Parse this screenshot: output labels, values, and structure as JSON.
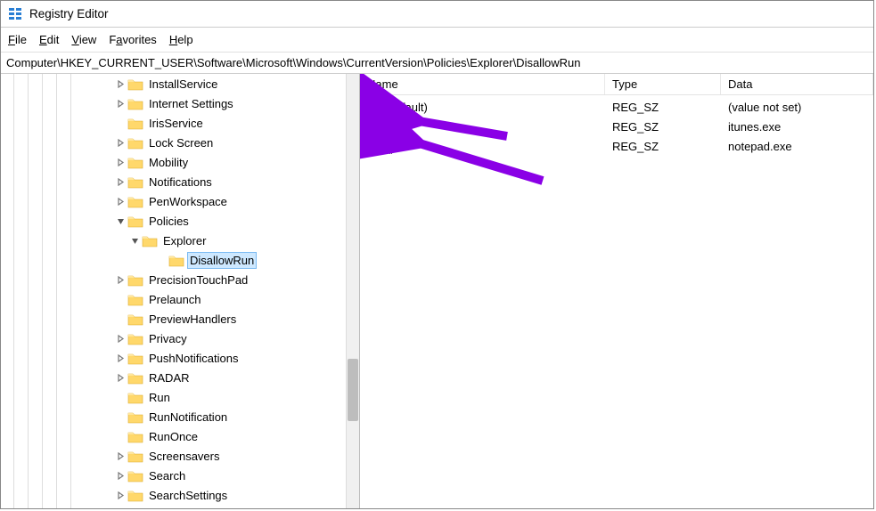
{
  "window": {
    "title": "Registry Editor"
  },
  "menubar": {
    "file": "File",
    "edit": "Edit",
    "view": "View",
    "favorites": "Favorites",
    "help": "Help"
  },
  "address": "Computer\\HKEY_CURRENT_USER\\Software\\Microsoft\\Windows\\CurrentVersion\\Policies\\Explorer\\DisallowRun",
  "tree": {
    "items": [
      {
        "indent": 128,
        "expander": "right",
        "label": "InstallService"
      },
      {
        "indent": 128,
        "expander": "right",
        "label": "Internet Settings"
      },
      {
        "indent": 128,
        "expander": "",
        "label": "IrisService"
      },
      {
        "indent": 128,
        "expander": "right",
        "label": "Lock Screen"
      },
      {
        "indent": 128,
        "expander": "right",
        "label": "Mobility"
      },
      {
        "indent": 128,
        "expander": "right",
        "label": "Notifications"
      },
      {
        "indent": 128,
        "expander": "right",
        "label": "PenWorkspace"
      },
      {
        "indent": 128,
        "expander": "down",
        "label": "Policies"
      },
      {
        "indent": 144,
        "expander": "down",
        "label": "Explorer"
      },
      {
        "indent": 174,
        "expander": "",
        "label": "DisallowRun",
        "selected": true
      },
      {
        "indent": 128,
        "expander": "right",
        "label": "PrecisionTouchPad"
      },
      {
        "indent": 128,
        "expander": "",
        "label": "Prelaunch"
      },
      {
        "indent": 128,
        "expander": "",
        "label": "PreviewHandlers"
      },
      {
        "indent": 128,
        "expander": "right",
        "label": "Privacy"
      },
      {
        "indent": 128,
        "expander": "right",
        "label": "PushNotifications"
      },
      {
        "indent": 128,
        "expander": "right",
        "label": "RADAR"
      },
      {
        "indent": 128,
        "expander": "",
        "label": "Run"
      },
      {
        "indent": 128,
        "expander": "",
        "label": "RunNotification"
      },
      {
        "indent": 128,
        "expander": "",
        "label": "RunOnce"
      },
      {
        "indent": 128,
        "expander": "right",
        "label": "Screensavers"
      },
      {
        "indent": 128,
        "expander": "right",
        "label": "Search"
      },
      {
        "indent": 128,
        "expander": "right",
        "label": "SearchSettings"
      }
    ],
    "scrollbar": {
      "thumbTop": 320,
      "thumbHeight": 70
    }
  },
  "list": {
    "columns": {
      "name": "Name",
      "type": "Type",
      "data": "Data"
    },
    "rows": [
      {
        "name": "(Default)",
        "type": "REG_SZ",
        "data": "(value not set)",
        "editing": false
      },
      {
        "name": "1",
        "type": "REG_SZ",
        "data": "itunes.exe",
        "editing": false
      },
      {
        "name": "2",
        "type": "REG_SZ",
        "data": "notepad.exe",
        "editing": true
      }
    ]
  },
  "annotation": {
    "color": "#8a00e6"
  }
}
